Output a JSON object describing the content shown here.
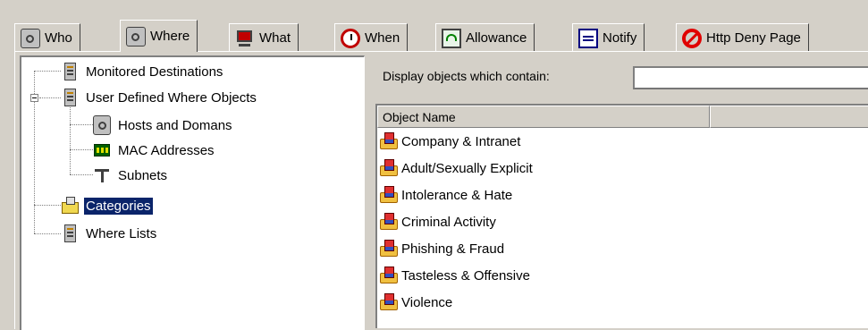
{
  "tabs": [
    {
      "label": "Who",
      "icon": "house-icon"
    },
    {
      "label": "Where",
      "icon": "house-icon"
    },
    {
      "label": "What",
      "icon": "monitor-icon"
    },
    {
      "label": "When",
      "icon": "clock-icon"
    },
    {
      "label": "Allowance",
      "icon": "gauge-icon"
    },
    {
      "label": "Notify",
      "icon": "notify-icon"
    },
    {
      "label": "Http Deny Page",
      "icon": "deny-icon"
    }
  ],
  "tree": {
    "items": [
      {
        "label": "Monitored Destinations",
        "icon": "server-icon"
      },
      {
        "label": "User Defined Where Objects",
        "icon": "server-icon"
      },
      {
        "label": "Hosts and Domans",
        "icon": "house-icon"
      },
      {
        "label": "MAC Addresses",
        "icon": "chip-icon"
      },
      {
        "label": "Subnets",
        "icon": "subnet-icon"
      },
      {
        "label": "Categories",
        "icon": "folder-icon"
      },
      {
        "label": "Where Lists",
        "icon": "server-icon"
      }
    ]
  },
  "filter": {
    "label": "Display objects which contain:",
    "value": ""
  },
  "list": {
    "column": "Object Name",
    "rows": [
      "Company & Intranet",
      "Adult/Sexually Explicit",
      "Intolerance & Hate",
      "Criminal Activity",
      "Phishing & Fraud",
      "Tasteless & Offensive",
      "Violence"
    ]
  }
}
